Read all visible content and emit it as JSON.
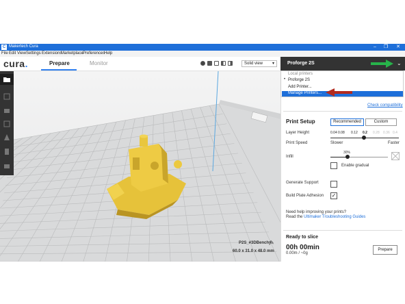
{
  "window": {
    "title": "Makertech Cura",
    "logo_letter": "C",
    "controls": [
      "–",
      "❐",
      "✕"
    ]
  },
  "menu": [
    "File",
    "Edit",
    "View",
    "Settings",
    "Extensions",
    "Marketplace",
    "Preferences",
    "Help"
  ],
  "header": {
    "brand": "cura",
    "brand_dot": ".",
    "tabs": [
      {
        "label": "Prepare",
        "active": true
      },
      {
        "label": "Monitor",
        "active": false
      }
    ],
    "view_mode": "Solid view",
    "view_icons": [
      "3d-view-icon",
      "front-view-icon",
      "top-view-icon",
      "left-view-icon",
      "right-view-icon"
    ]
  },
  "toolbar": {
    "tools": [
      "open-file-icon",
      "move-icon",
      "scale-icon",
      "rotate-icon",
      "mirror-icon",
      "per-model-settings-icon",
      "support-blocker-icon"
    ]
  },
  "printer": {
    "selected": "Proforge 2S",
    "dropdown": {
      "section_label": "Local printers",
      "items": [
        "Proforge 2S"
      ],
      "add": "Add Printer...",
      "manage": "Manage Printers..."
    },
    "check_compat": "Check compatibility"
  },
  "print_setup": {
    "title": "Print Setup",
    "mode_recommended": "Recommended",
    "mode_custom": "Custom",
    "layer_height_label": "Layer Height",
    "layer_values": [
      "0.04",
      "0.08",
      "0.12",
      "0.2",
      "0.28",
      "0.36",
      "0.4"
    ],
    "layer_selected": "0.2",
    "print_speed_label": "Print Speed",
    "speed_slower": "Slower",
    "speed_faster": "Faster",
    "infill_label": "Infill",
    "infill_value": "30%",
    "infill_fraction": 0.3,
    "enable_gradual": "Enable gradual",
    "enable_gradual_checked": false,
    "generate_support_label": "Generate Support",
    "generate_support_checked": false,
    "adhesion_label": "Build Plate Adhesion",
    "adhesion_checked": true,
    "help_line1": "Need help improving your prints?",
    "help_line2_prefix": "Read the ",
    "help_link": "Ultimaker Troubleshooting Guides"
  },
  "slice": {
    "title": "Ready to slice",
    "time": "00h 00min",
    "material": "0.00m / ~0g",
    "prepare_button": "Prepare"
  },
  "model": {
    "name": "P2S_#3DBenchy",
    "dimensions": "60.0 x 31.0 x 48.0 mm"
  },
  "colors": {
    "accent": "#1e6fd9",
    "model": "#e8c53a",
    "annotation_green": "#27b34a",
    "annotation_red": "#b22a1e"
  }
}
